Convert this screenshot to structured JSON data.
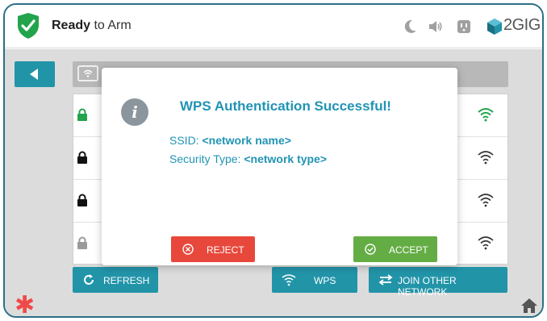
{
  "header": {
    "status_bold": "Ready",
    "status_rest": " to Arm",
    "brand": "2GIG",
    "icons": [
      "shield-check-icon",
      "moon-icon",
      "speaker-icon",
      "outlet-icon",
      "brand-logo-icon"
    ],
    "colors": {
      "shield": "#21a44b",
      "accent": "#2294a8"
    }
  },
  "networks": [
    {
      "lock": "locked-green",
      "signal": "strong-green"
    },
    {
      "lock": "locked",
      "signal": "full"
    },
    {
      "lock": "locked",
      "signal": "full"
    },
    {
      "lock": "locked-grey",
      "signal": "full"
    }
  ],
  "toolbar": {
    "refresh_label": "REFRESH",
    "wps_label": "WPS",
    "join_label": "JOIN OTHER NETWORK"
  },
  "dialog": {
    "title": "WPS Authentication Successful!",
    "ssid_label": "SSID: ",
    "ssid_value": "<network name>",
    "security_label": "Security Type: ",
    "security_value": "<network type>",
    "reject_label": "REJECT",
    "accept_label": "ACCEPT",
    "colors": {
      "reject": "#e8483c",
      "accept": "#64ad45",
      "title": "#2194b4"
    }
  },
  "footer": {
    "icons": [
      "asterisk-icon",
      "home-icon"
    ]
  }
}
